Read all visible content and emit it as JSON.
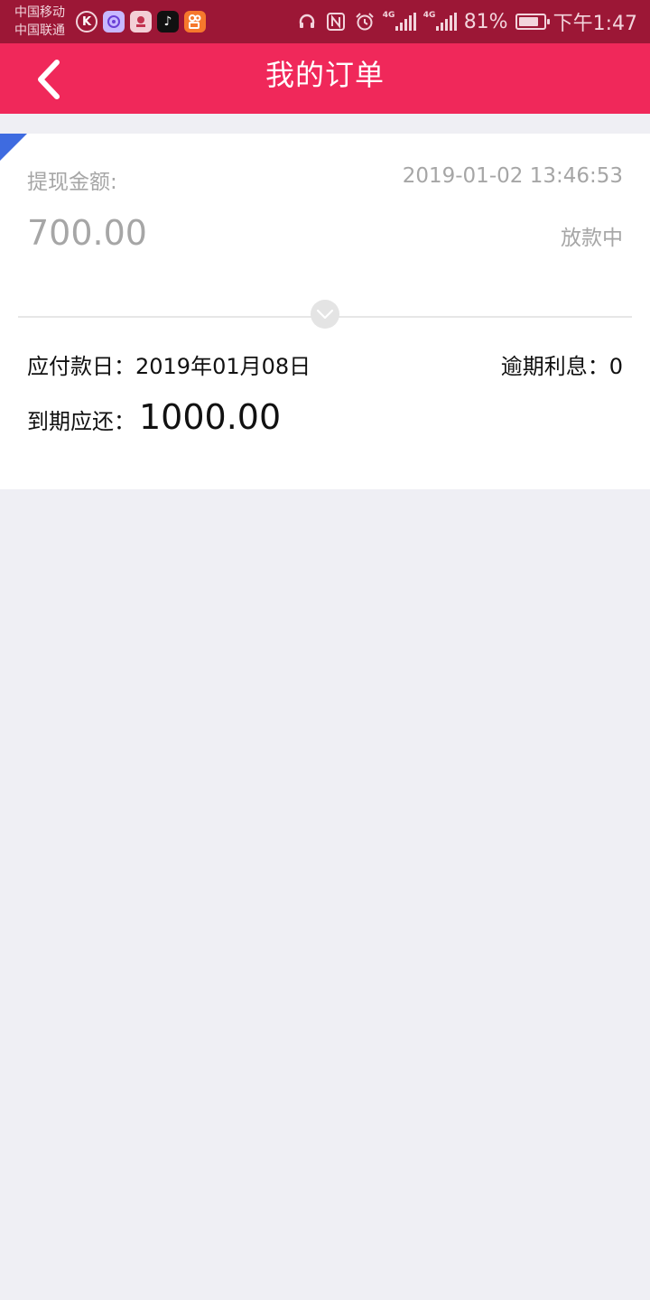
{
  "status_bar": {
    "carrier_1": "中国移动",
    "carrier_2": "中国联通",
    "apps": [
      "k-app-icon",
      "chat-app-icon",
      "photo-app-icon",
      "tiktok-icon",
      "kuaishou-icon"
    ],
    "network_1": "4G",
    "network_2": "4G",
    "battery_percent": "81%",
    "battery_level": 0.81,
    "time": "下午1:47"
  },
  "header": {
    "title": "我的订单",
    "background": "#f0285a"
  },
  "order": {
    "amount_label": "提现金额:",
    "created_at": "2019-01-02 13:46:53",
    "amount": "700.00",
    "status": "放款中",
    "due_date_label": "应付款日：",
    "due_date": "2019年01月08日",
    "overdue_interest_label": "逾期利息：",
    "overdue_interest": "0",
    "repay_label": "到期应还：",
    "repay_amount": "1000.00",
    "corner_color": "#3e6be0"
  }
}
